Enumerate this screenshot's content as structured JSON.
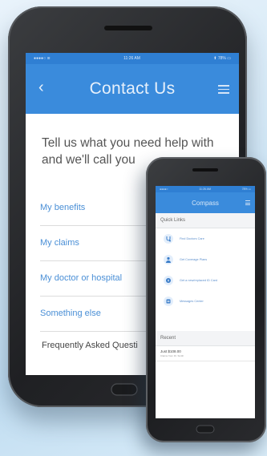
{
  "big_phone": {
    "status": {
      "carrier": "●●●●○ ≋",
      "time": "11:26 AM",
      "battery": "⬆ 78% ▭"
    },
    "appbar": {
      "title": "Contact Us",
      "back": "‹"
    },
    "heading": "Tell us what you need help with and we'll call you",
    "options": [
      "My benefits",
      "My claims",
      "My doctor or hospital",
      "Something else"
    ],
    "faq_label": "Frequently Asked Questi"
  },
  "small_phone": {
    "status": {
      "carrier": "●●●●○",
      "time": "11:26 AM",
      "battery": "78% ▭"
    },
    "appbar": {
      "title": "Compass"
    },
    "quick_links_label": "Quick Links",
    "quick_links": [
      {
        "label": "Find Doctors Care",
        "icon": "stethoscope-icon"
      },
      {
        "label": "Get Coverage Plans",
        "icon": "person-icon"
      },
      {
        "label": "Get a new/replaced ID Card",
        "icon": "id-card-icon"
      },
      {
        "label": "Messages Center",
        "icon": "message-icon"
      }
    ],
    "recent_label": "Recent",
    "recent_item": {
      "title": "Just $108.00",
      "subtitle": "Claims from Dr. Smith"
    }
  },
  "colors": {
    "accent_blue": "#3a8bdc",
    "status_blue": "#2f7fd3",
    "link_blue": "#4a8fd6",
    "phone_body": "#1f2023"
  }
}
